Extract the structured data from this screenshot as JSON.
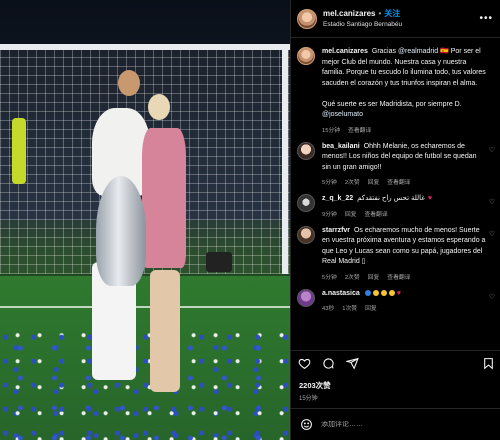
{
  "post": {
    "username": "mel.canizares",
    "separator": "•",
    "follow_label": "关注",
    "location": "Estadio Santiago Bernabéu",
    "more_icon": "more-options-icon"
  },
  "caption": {
    "username": "mel.canizares",
    "text_1": "Gracias ",
    "mention_1": "@realmadrid",
    "text_2": " 🇪🇸 Por ser el mejor Club del mundo. Nuestra casa y nuestra familia. Porque tu escudo lo ilumina todo, tus valores sacuden el corazón y tus triunfos inspiran el alma.",
    "text_3": "Qué suerte es ser Madridista, por siempre D. ",
    "mention_2": "@joselumato",
    "time": "15分钟",
    "translate": "查看翻译"
  },
  "comments": [
    {
      "username": "bea_kailani",
      "text": "Ohhh Melanie, os echaremos de menos!! Los niños del equipo de futbol se quedan sin un gran amigo!!",
      "time": "5分钟",
      "likes": "2次赞",
      "reply": "回复",
      "translate": "查看翻译"
    },
    {
      "username": "z_q_k_22",
      "text": "غاللة تحس راح نفتقدكم",
      "time": "9分钟",
      "reply": "回复",
      "translate": "查看翻译"
    },
    {
      "username": "starrzfvr",
      "text": "Os echaremos mucho de menos! Suerte en vuestra próxima aventura y estamos esperando a que Leo y Lucas sean como su papá, jugadores del Real Madrid ▯",
      "time": "5分钟",
      "likes": "2次赞",
      "reply": "回复",
      "translate": "查看翻译"
    },
    {
      "username": "a.nastasica",
      "text": "",
      "time": "43秒",
      "likes": "1次赞",
      "reply": "回复"
    }
  ],
  "actions": {
    "like_icon": "heart-icon",
    "comment_icon": "comment-icon",
    "share_icon": "share-icon",
    "save_icon": "bookmark-icon"
  },
  "likes_count": "2203次赞",
  "posted": "15分钟",
  "add_comment": {
    "placeholder": "添加评论……",
    "emoji_icon": "smiley-icon"
  },
  "colors": {
    "background": "#000000",
    "text": "#f5f5f5",
    "muted": "#a8a8a8",
    "accent": "#0095f6",
    "divider": "#262626"
  }
}
